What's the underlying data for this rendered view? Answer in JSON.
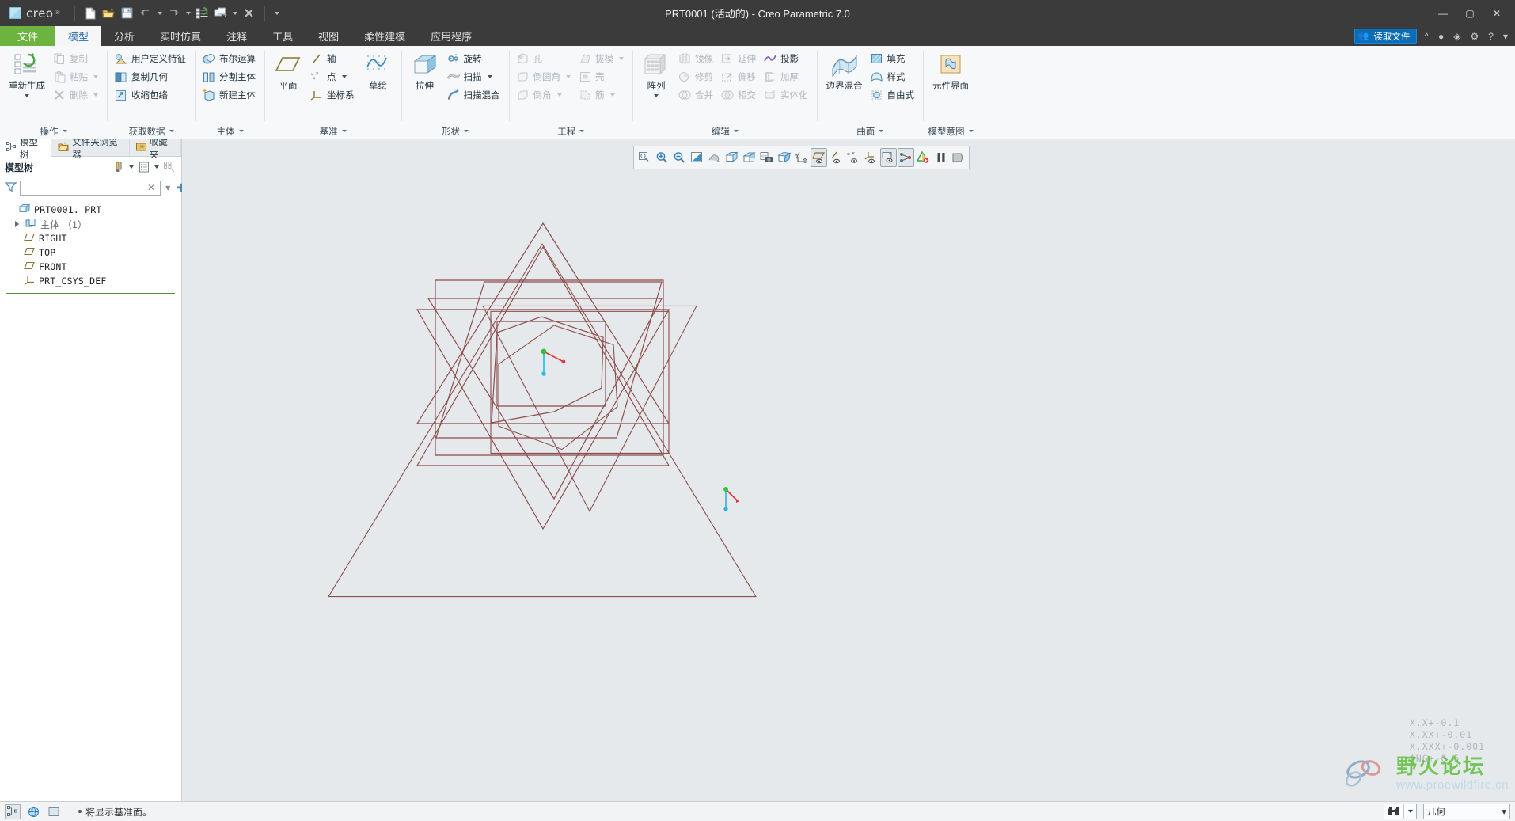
{
  "window": {
    "title": "PRT0001 (活动的) - Creo Parametric 7.0",
    "brand": "creo",
    "brand_mark": "®",
    "minimize": "—",
    "maximize": "▢",
    "close": "✕"
  },
  "quick_access": [
    {
      "name": "new-file",
      "icon": "new-document-icon"
    },
    {
      "name": "open-file",
      "icon": "open-folder-icon"
    },
    {
      "name": "save-file",
      "icon": "save-disk-icon"
    },
    {
      "name": "undo",
      "icon": "undo-arrow-icon",
      "has_caret": true
    },
    {
      "name": "redo",
      "icon": "redo-arrow-icon",
      "has_caret": true
    },
    {
      "name": "regenerate",
      "icon": "regenerate-icon"
    },
    {
      "name": "window-switch",
      "icon": "window-switch-icon",
      "has_caret": true
    },
    {
      "name": "close-window",
      "icon": "close-x-icon"
    },
    {
      "name": "customize-qat",
      "icon": "chevron-down-icon"
    }
  ],
  "ribbon_tabs": [
    {
      "label": "文件",
      "kind": "file"
    },
    {
      "label": "模型",
      "kind": "active"
    },
    {
      "label": "分析",
      "kind": "normal"
    },
    {
      "label": "实时仿真",
      "kind": "normal"
    },
    {
      "label": "注释",
      "kind": "normal"
    },
    {
      "label": "工具",
      "kind": "normal"
    },
    {
      "label": "视图",
      "kind": "normal"
    },
    {
      "label": "柔性建模",
      "kind": "normal"
    },
    {
      "label": "应用程序",
      "kind": "normal"
    }
  ],
  "title_right": {
    "read_file_label": "读取文件",
    "read_file_icon": "people-icon",
    "icons": [
      "chevron-up-icon",
      "user-icon",
      "bell-icon",
      "gear-icon",
      "help-icon"
    ]
  },
  "ribbon_groups": [
    {
      "label": "操作",
      "big": [
        {
          "label": "重新生成",
          "icon": "regenerate-big-icon",
          "has_drop": true,
          "disabled": false
        }
      ],
      "small": [
        {
          "label": "复制",
          "icon": "copy-icon",
          "disabled": true,
          "has_drop": false
        },
        {
          "label": "粘贴",
          "icon": "paste-icon",
          "disabled": true,
          "has_drop": true
        },
        {
          "label": "删除",
          "icon": "delete-x-icon",
          "disabled": true,
          "has_drop": true
        }
      ]
    },
    {
      "label": "获取数据",
      "big": [],
      "small": [
        {
          "label": "用户定义特征",
          "icon": "udf-icon",
          "disabled": false,
          "has_drop": false
        },
        {
          "label": "复制几何",
          "icon": "copy-geometry-icon",
          "disabled": false,
          "has_drop": false
        },
        {
          "label": "收缩包络",
          "icon": "shrinkwrap-icon",
          "disabled": false,
          "has_drop": false
        }
      ]
    },
    {
      "label": "主体",
      "big": [],
      "small": [
        {
          "label": "布尔运算",
          "icon": "boolean-icon",
          "disabled": false,
          "has_drop": false
        },
        {
          "label": "分割主体",
          "icon": "split-body-icon",
          "disabled": false,
          "has_drop": false
        },
        {
          "label": "新建主体",
          "icon": "new-body-icon",
          "disabled": false,
          "has_drop": false
        }
      ]
    },
    {
      "label": "基准",
      "big": [
        {
          "label": "平面",
          "icon": "datum-plane-icon",
          "has_drop": false,
          "disabled": false
        },
        {
          "label": "草绘",
          "icon": "sketch-icon",
          "has_drop": false,
          "disabled": false
        }
      ],
      "small": [
        {
          "label": "轴",
          "icon": "datum-axis-icon",
          "disabled": false,
          "has_drop": false
        },
        {
          "label": "点",
          "icon": "datum-point-icon",
          "disabled": false,
          "has_drop": true
        },
        {
          "label": "坐标系",
          "icon": "coordinate-system-icon",
          "disabled": false,
          "has_drop": false
        }
      ]
    },
    {
      "label": "形状",
      "big": [
        {
          "label": "拉伸",
          "icon": "extrude-icon",
          "has_drop": false,
          "disabled": false
        }
      ],
      "small": [
        {
          "label": "旋转",
          "icon": "revolve-icon",
          "disabled": false,
          "has_drop": false
        },
        {
          "label": "扫描",
          "icon": "sweep-icon",
          "disabled": false,
          "has_drop": true
        },
        {
          "label": "扫描混合",
          "icon": "swept-blend-icon",
          "disabled": false,
          "has_drop": false
        }
      ]
    },
    {
      "label": "工程",
      "big": [],
      "small": [
        {
          "label": "孔",
          "icon": "hole-icon",
          "disabled": true,
          "has_drop": false
        },
        {
          "label": "倒圆角",
          "icon": "round-icon",
          "disabled": true,
          "has_drop": true
        },
        {
          "label": "倒角",
          "icon": "chamfer-icon",
          "disabled": true,
          "has_drop": true
        }
      ],
      "small2": [
        {
          "label": "拔模",
          "icon": "draft-icon",
          "disabled": true,
          "has_drop": true
        },
        {
          "label": "壳",
          "icon": "shell-icon",
          "disabled": true,
          "has_drop": false
        },
        {
          "label": "筋",
          "icon": "rib-icon",
          "disabled": true,
          "has_drop": true
        }
      ]
    },
    {
      "label": "编辑",
      "big": [
        {
          "label": "阵列",
          "icon": "pattern-icon",
          "has_drop": true,
          "disabled": true
        }
      ],
      "small": [
        {
          "label": "镜像",
          "icon": "mirror-icon",
          "disabled": true,
          "has_drop": false
        },
        {
          "label": "修剪",
          "icon": "trim-icon",
          "disabled": true,
          "has_drop": false
        },
        {
          "label": "合并",
          "icon": "merge-icon",
          "disabled": true,
          "has_drop": false
        }
      ],
      "small2": [
        {
          "label": "延伸",
          "icon": "extend-icon",
          "disabled": true,
          "has_drop": false
        },
        {
          "label": "偏移",
          "icon": "offset-icon",
          "disabled": true,
          "has_drop": false
        },
        {
          "label": "相交",
          "icon": "intersect-icon",
          "disabled": true,
          "has_drop": false
        }
      ],
      "small3": [
        {
          "label": "投影",
          "icon": "project-icon",
          "disabled": false,
          "has_drop": false
        },
        {
          "label": "加厚",
          "icon": "thicken-icon",
          "disabled": true,
          "has_drop": false
        },
        {
          "label": "实体化",
          "icon": "solidify-icon",
          "disabled": true,
          "has_drop": false
        }
      ]
    },
    {
      "label": "曲面",
      "big": [
        {
          "label": "边界混合",
          "icon": "boundary-blend-icon",
          "has_drop": false,
          "disabled": false
        }
      ],
      "small": [
        {
          "label": "填充",
          "icon": "fill-icon",
          "disabled": false,
          "has_drop": false
        },
        {
          "label": "样式",
          "icon": "style-icon",
          "disabled": false,
          "has_drop": false
        },
        {
          "label": "自由式",
          "icon": "freestyle-icon",
          "disabled": false,
          "has_drop": false
        }
      ]
    },
    {
      "label": "模型意图",
      "big": [
        {
          "label": "元件界面",
          "icon": "component-interface-icon",
          "has_drop": false,
          "disabled": false
        }
      ],
      "small": []
    }
  ],
  "sidebar": {
    "nav_tabs": [
      {
        "label": "模型树",
        "icon": "model-tree-icon",
        "active": true
      },
      {
        "label": "文件夹浏览器",
        "icon": "folder-browser-icon",
        "active": false
      },
      {
        "label": "收藏夹",
        "icon": "favorites-star-icon",
        "active": false
      }
    ],
    "panel_title": "模型树",
    "panel_tools": [
      {
        "name": "settings-tools-icon",
        "caret": true
      },
      {
        "name": "display-list-icon",
        "caret": true
      },
      {
        "name": "tree-filters-icon",
        "caret": false
      }
    ],
    "filter": {
      "icon": "funnel-filter-icon",
      "value": "",
      "placeholder": "",
      "clear": "✕",
      "caret": "▾",
      "add": "✚"
    },
    "tree": [
      {
        "label": "PRT0001. PRT",
        "icon": "part-icon",
        "indent": 0,
        "expander": false,
        "mono": true
      },
      {
        "label": "主体 （1）",
        "icon": "bodies-icon",
        "indent": 0,
        "expander": true,
        "mono": false
      },
      {
        "label": "RIGHT",
        "icon": "datum-plane-tree-icon",
        "indent": 1,
        "expander": false,
        "mono": true
      },
      {
        "label": "TOP",
        "icon": "datum-plane-tree-icon",
        "indent": 1,
        "expander": false,
        "mono": true
      },
      {
        "label": "FRONT",
        "icon": "datum-plane-tree-icon",
        "indent": 1,
        "expander": false,
        "mono": true
      },
      {
        "label": "PRT_CSYS_DEF",
        "icon": "csys-tree-icon",
        "indent": 1,
        "expander": false,
        "mono": true
      }
    ]
  },
  "graphics_toolbar": [
    {
      "name": "refit-zoom-icon",
      "group": 0
    },
    {
      "name": "zoom-in-icon",
      "group": 0
    },
    {
      "name": "zoom-out-icon",
      "group": 0
    },
    {
      "name": "repaint-icon",
      "group": 0
    },
    {
      "name": "spin-center-icon",
      "group": 0,
      "corner": true
    },
    {
      "name": "saved-views-icon",
      "group": 0,
      "corner": true
    },
    {
      "name": "view-manager-icon",
      "group": 0,
      "corner": true
    },
    {
      "name": "screen-capture-icon",
      "group": 0
    },
    {
      "name": "display-style-icon",
      "group": 0
    },
    {
      "name": "datum-display-all-icon",
      "group": 1,
      "corner": true
    },
    {
      "name": "plane-display-icon",
      "group": 1,
      "pressed": true
    },
    {
      "name": "axis-display-icon",
      "group": 1
    },
    {
      "name": "point-display-icon",
      "group": 1
    },
    {
      "name": "csys-display-icon",
      "group": 1
    },
    {
      "name": "annotation-display-icon",
      "group": 2,
      "pressed": true
    },
    {
      "name": "spin-center-toggle-icon",
      "group": 2,
      "pressed": true
    },
    {
      "name": "appearance-gallery-icon",
      "group": 3
    },
    {
      "name": "pause-icon",
      "group": 3
    },
    {
      "name": "stop-icon",
      "group": 3
    }
  ],
  "viewport": {
    "tolerance_lines": [
      "X.X+-0.1",
      "X.XX+-0.01",
      "X.XXX+-0.001",
      "ANG+-0.5"
    ],
    "watermark_main": "野火论坛",
    "watermark_sub": "www.proewildfire.cn",
    "csys_label": ""
  },
  "statusbar": {
    "buttons": [
      {
        "name": "selection-filter-icon",
        "active": true
      },
      {
        "name": "global-view-icon",
        "active": false
      },
      {
        "name": "window-panel-icon",
        "active": false
      }
    ],
    "message": "将显示基准面。",
    "search_icon": "binoculars-search-icon",
    "search_caret": "▾",
    "filter_value": "几何",
    "filter_caret": "▾"
  }
}
